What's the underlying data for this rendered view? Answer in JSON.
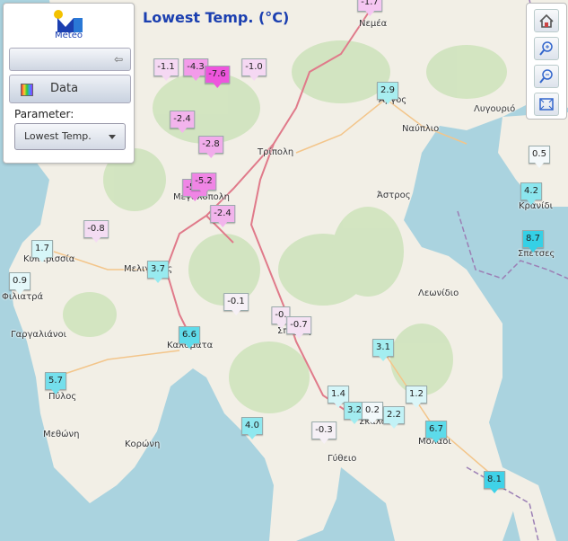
{
  "title": "Lowest Temp. (°C)",
  "panel": {
    "logo_text": "Meteo",
    "data_label": "Data",
    "parameter_label": "Parameter:",
    "parameter_value": "Lowest Temp."
  },
  "toolbar": {
    "home": "home-icon",
    "zoom_in": "zoom-in-icon",
    "zoom_out": "zoom-out-icon",
    "fullscreen": "fullscreen-icon"
  },
  "places": [
    {
      "name": "Νεμέα"
    },
    {
      "name": "Άργος"
    },
    {
      "name": "Ναύπλιο"
    },
    {
      "name": "Λυγουριό"
    },
    {
      "name": "Τρίπολη"
    },
    {
      "name": "Άστρος"
    },
    {
      "name": "Κρανίδι"
    },
    {
      "name": "Σπέτσες"
    },
    {
      "name": "Μεγαλόπολη"
    },
    {
      "name": "Κυπαρισσία"
    },
    {
      "name": "Μελιγαλάς"
    },
    {
      "name": "Φιλιατρά"
    },
    {
      "name": "Γαργαλιάνοι"
    },
    {
      "name": "Καλαμάτα"
    },
    {
      "name": "Σπάρτη"
    },
    {
      "name": "Λεωνίδιο"
    },
    {
      "name": "Πύλος"
    },
    {
      "name": "Μεθώνη"
    },
    {
      "name": "Κορώνη"
    },
    {
      "name": "Σκάλα"
    },
    {
      "name": "Γύθειο"
    },
    {
      "name": "Μολάοι"
    }
  ],
  "markers": [
    {
      "value": "-1.7",
      "color": "#f5c6f2"
    },
    {
      "value": "-1.1",
      "color": "#f5d8f3"
    },
    {
      "value": "-4.3",
      "color": "#f39be9"
    },
    {
      "value": "-7.6",
      "color": "#ee55dd"
    },
    {
      "value": "-1.0",
      "color": "#f5d8f3"
    },
    {
      "value": "2.9",
      "color": "#a8eef0"
    },
    {
      "value": "-2.4",
      "color": "#f2b4ec"
    },
    {
      "value": "-2.8",
      "color": "#f1aceb"
    },
    {
      "value": "0.5",
      "color": "#f4f9fb"
    },
    {
      "value": "-5.2",
      "color": "#f085e5"
    },
    {
      "value": "-5.2",
      "color": "#f085e5"
    },
    {
      "value": "-2.4",
      "color": "#f2b4ec"
    },
    {
      "value": "4.2",
      "color": "#8be6ee"
    },
    {
      "value": "-0.8",
      "color": "#f4dcf3"
    },
    {
      "value": "8.7",
      "color": "#35d0e6"
    },
    {
      "value": "1.7",
      "color": "#d6f6f8"
    },
    {
      "value": "0.9",
      "color": "#e4f8fa"
    },
    {
      "value": "3.7",
      "color": "#98eaef"
    },
    {
      "value": "-0.1",
      "color": "#f6f0f6"
    },
    {
      "value": "-0.",
      "color": "#f4e4f3"
    },
    {
      "value": "-0.7",
      "color": "#f4e1f3"
    },
    {
      "value": "6.6",
      "color": "#5fdbea"
    },
    {
      "value": "3.1",
      "color": "#a4eef0"
    },
    {
      "value": "5.7",
      "color": "#74dfec"
    },
    {
      "value": "1.4",
      "color": "#d4f5f8"
    },
    {
      "value": "1.2",
      "color": "#dbf6f8"
    },
    {
      "value": "3.2",
      "color": "#a2ecf0"
    },
    {
      "value": "0.2",
      "color": "#f2f8fa"
    },
    {
      "value": "2.2",
      "color": "#c2f2f6"
    },
    {
      "value": "4.0",
      "color": "#8fe8ef"
    },
    {
      "value": "-0.3",
      "color": "#f6f0f6"
    },
    {
      "value": "6.7",
      "color": "#5ddbea"
    },
    {
      "value": "8.1",
      "color": "#3fd2e8"
    }
  ]
}
